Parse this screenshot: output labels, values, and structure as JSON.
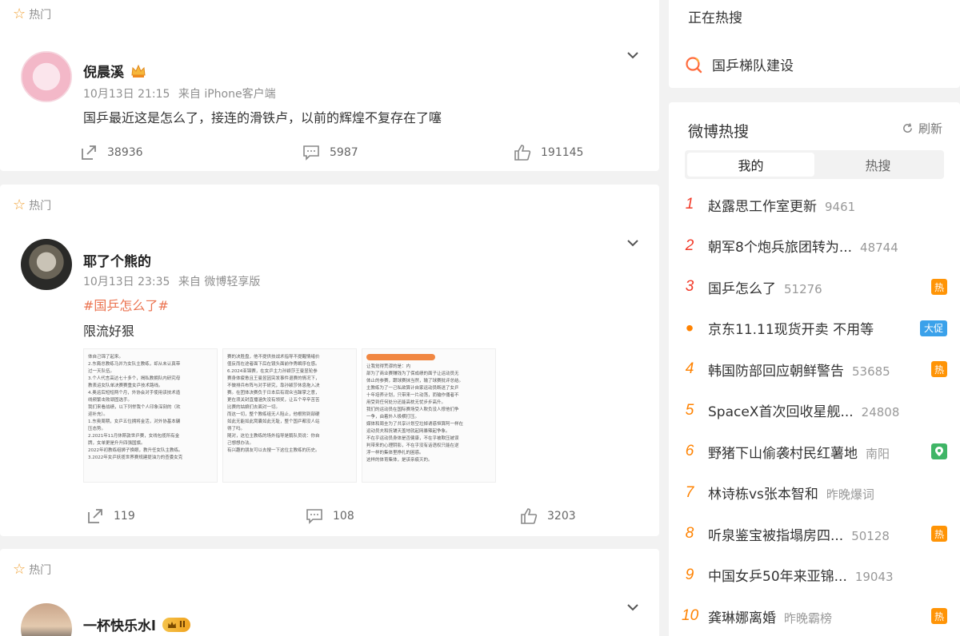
{
  "feed": {
    "hot_label": "热门",
    "posts": [
      {
        "author": "倪晨溪",
        "time": "10月13日 21:15",
        "source": "来自 iPhone客户端",
        "text": "国乒最近这是怎么了，接连的滑铁卢，以前的辉煌不复存在了噻",
        "reposts": "38936",
        "comments": "5987",
        "likes": "191145"
      },
      {
        "author": "耶了个熊的",
        "time": "10月13日 23:35",
        "source": "来自 微博轻享版",
        "topic": "#国乒怎么了#",
        "text": "限流好狠",
        "reposts": "119",
        "comments": "108",
        "likes": "3203",
        "images": [
          {
            "lines": [
              "体自己锦了起来。",
              "2.东裔总教练马并为女队主教练，却从未认真带",
              "过一天队伍。",
              "3.个人代言高达七十多个，揭私教拥队内研究母",
              "教表运女队单决赛赛重女乒技术路线。",
              "4.奥运后短短两个月，外协会对手使用该技术造",
              "线频繁击败顽固选手。",
              "我们来看战绩，以下列举我个人印象深刻的（欢",
              "迎补充）。",
              "1.东奥周期，女乒五位拥将金活，对外协基本碾",
              "压态势。",
              "2.2021年11月休斯敦世乒赛，女线包揽所有金",
              "牌，女单更是升升四强国旗。",
              "2022年初教练组狮子换眼，教升任女队主教练。",
              "3.2022年女乒妖揽世界赛规建提油力的查委女克"
            ]
          },
          {
            "lines": [
              "赛的决胜盘，他不提供技战术指导不提醒情绪价",
              "值反而在途者面下后在镜头面前作秀瞬序在感。",
              "6.2024亚锦赛，在女乒主力孙颖莎王曼昱轮参",
              "赛身体疲惫且王曼昱因突发事件退赛的情况下，",
              "不做排兵布阵与对手研究，靠孙颖莎休息拖入决",
              "赛。在团体决赛负于日本后有观众当躁掌之意，",
              "更在须关封直播涵失没有领奖，让五个辛辛苦苦",
              "比赛的姑娘们去面对一切。",
              "而这一切，整个教练组无人阻止，他根附到部硬",
              "如此无能如此窝囊如此无耻，整个国乒都没人站",
              "得了吗。",
              "",
              "随对，这位主教练的场外指导是鹅队员说：你自",
              "己想想办法。",
              "有兴趣的朋友可以去搜一下这位主教练的历史。"
            ]
          },
          {
            "lines": [
              "让我觉得荒谬的是：内",
              "部为了商业赛赚钱为了保成绩的面子让运动员无",
              "体止的参赛，跟球赛抹当然，输了球赛批评总结。",
              "主教练为了一己私欲算计自家运动员断送了女乒",
              "十年培养计划，只带来一片动荡，而输作俑者不",
              "用受到任何处分还能高枕无忧步步高升。",
              "我们的运动员在国际赛场受人欺负没人撑他们争",
              "一争，由着外人极横打压。",
              "媒体和周圭为了共享计划空垃掉诱惑恒算阿一样在",
              "运动员夫和抚铺天盖地就起网暴辣起争象。",
              "不在乎运动员身体是否健康，不在乎被欺压被误",
              "判带来的心理阴影，不在乎没有话语权只能在逆",
              "浮一样的集体里挣扎的困惑。",
              "这样的体育集体，是该亲痕灭的。"
            ]
          }
        ]
      },
      {
        "author": "一杯快乐水l",
        "badge": "II"
      }
    ]
  },
  "sidebar": {
    "now_searching": "正在热搜",
    "search_term": "国乒梯队建设",
    "hot_title": "微博热搜",
    "refresh_label": "刷新",
    "tabs": [
      "我的",
      "热搜"
    ],
    "hot_list": [
      {
        "rank": "1",
        "text": "赵露思工作室更新",
        "num": "9461",
        "tag": ""
      },
      {
        "rank": "2",
        "text": "朝军8个炮兵旅团转为...",
        "num": "48744",
        "tag": ""
      },
      {
        "rank": "3",
        "text": "国乒怎么了",
        "num": "51276",
        "tag": "热"
      },
      {
        "rank": "•",
        "text": "京东11.11现货开卖 不用等",
        "num": "",
        "tag": "大促"
      },
      {
        "rank": "4",
        "text": "韩国防部回应朝鲜警告",
        "num": "53685",
        "tag": "热"
      },
      {
        "rank": "5",
        "text": "SpaceX首次回收星舰...",
        "num": "24808",
        "tag": ""
      },
      {
        "rank": "6",
        "text": "野猪下山偷袭村民红薯地",
        "num": "南阳",
        "tag": "loc"
      },
      {
        "rank": "7",
        "text": "林诗栋vs张本智和",
        "num": "昨晚爆词",
        "tag": ""
      },
      {
        "rank": "8",
        "text": "听泉鉴宝被指塌房四...",
        "num": "50128",
        "tag": "热"
      },
      {
        "rank": "9",
        "text": "中国女乒50年来亚锦...",
        "num": "19043",
        "tag": ""
      },
      {
        "rank": "10",
        "text": "龚琳娜离婚",
        "num": "昨晚霸榜",
        "tag": "热"
      }
    ]
  }
}
